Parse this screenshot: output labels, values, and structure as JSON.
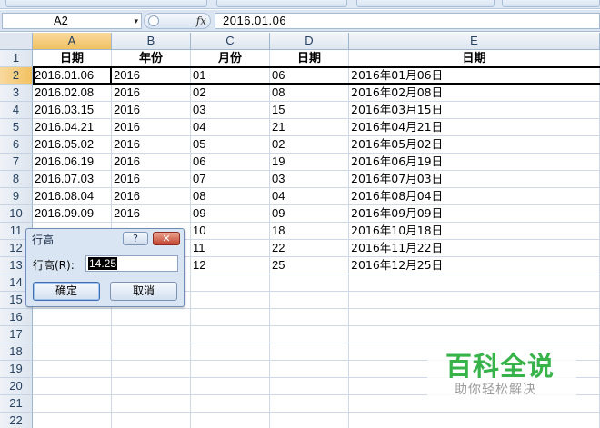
{
  "formula_bar": {
    "name_box": "A2",
    "dropdown_glyph": "▾",
    "fx_label": "fx",
    "formula": "2016.01.06"
  },
  "columns": [
    "A",
    "B",
    "C",
    "D",
    "E"
  ],
  "rows": [
    {
      "n": "1",
      "cells": [
        "日期",
        "年份",
        "月份",
        "日期",
        "日期"
      ]
    },
    {
      "n": "2",
      "cells": [
        "2016.01.06",
        "2016",
        "01",
        "06",
        "2016年01月06日"
      ]
    },
    {
      "n": "3",
      "cells": [
        "2016.02.08",
        "2016",
        "02",
        "08",
        "2016年02月08日"
      ]
    },
    {
      "n": "4",
      "cells": [
        "2016.03.15",
        "2016",
        "03",
        "15",
        "2016年03月15日"
      ]
    },
    {
      "n": "5",
      "cells": [
        "2016.04.21",
        "2016",
        "04",
        "21",
        "2016年04月21日"
      ]
    },
    {
      "n": "6",
      "cells": [
        "2016.05.02",
        "2016",
        "05",
        "02",
        "2016年05月02日"
      ]
    },
    {
      "n": "7",
      "cells": [
        "2016.06.19",
        "2016",
        "06",
        "19",
        "2016年06月19日"
      ]
    },
    {
      "n": "8",
      "cells": [
        "2016.07.03",
        "2016",
        "07",
        "03",
        "2016年07月03日"
      ]
    },
    {
      "n": "9",
      "cells": [
        "2016.08.04",
        "2016",
        "08",
        "04",
        "2016年08月04日"
      ]
    },
    {
      "n": "10",
      "cells": [
        "2016.09.09",
        "2016",
        "09",
        "09",
        "2016年09月09日"
      ]
    },
    {
      "n": "11",
      "cells": [
        "",
        "",
        "10",
        "18",
        "2016年10月18日"
      ]
    },
    {
      "n": "12",
      "cells": [
        "",
        "",
        "11",
        "22",
        "2016年11月22日"
      ]
    },
    {
      "n": "13",
      "cells": [
        "",
        "",
        "12",
        "25",
        "2016年12月25日"
      ]
    },
    {
      "n": "14",
      "cells": [
        "",
        "",
        "",
        "",
        ""
      ]
    },
    {
      "n": "15",
      "cells": [
        "",
        "",
        "",
        "",
        ""
      ]
    },
    {
      "n": "16",
      "cells": [
        "",
        "",
        "",
        "",
        ""
      ]
    },
    {
      "n": "17",
      "cells": [
        "",
        "",
        "",
        "",
        ""
      ]
    },
    {
      "n": "18",
      "cells": [
        "",
        "",
        "",
        "",
        ""
      ]
    },
    {
      "n": "19",
      "cells": [
        "",
        "",
        "",
        "",
        ""
      ]
    },
    {
      "n": "20",
      "cells": [
        "",
        "",
        "",
        "",
        ""
      ]
    },
    {
      "n": "21",
      "cells": [
        "",
        "",
        "",
        "",
        ""
      ]
    },
    {
      "n": "22",
      "cells": [
        "",
        "",
        "",
        "",
        ""
      ]
    }
  ],
  "dialog": {
    "title": "行高",
    "help_label": "?",
    "close_label": "✕",
    "field_label": "行高(R):",
    "field_value": "14.25",
    "ok_label": "确定",
    "cancel_label": "取消"
  },
  "watermark": {
    "brand": "百科全说",
    "slogan": "助你轻松解决"
  },
  "colors": {
    "selection_header": "#f1c15f",
    "watermark_green": "#37b34a",
    "header_bg": "#dfe6ef"
  }
}
